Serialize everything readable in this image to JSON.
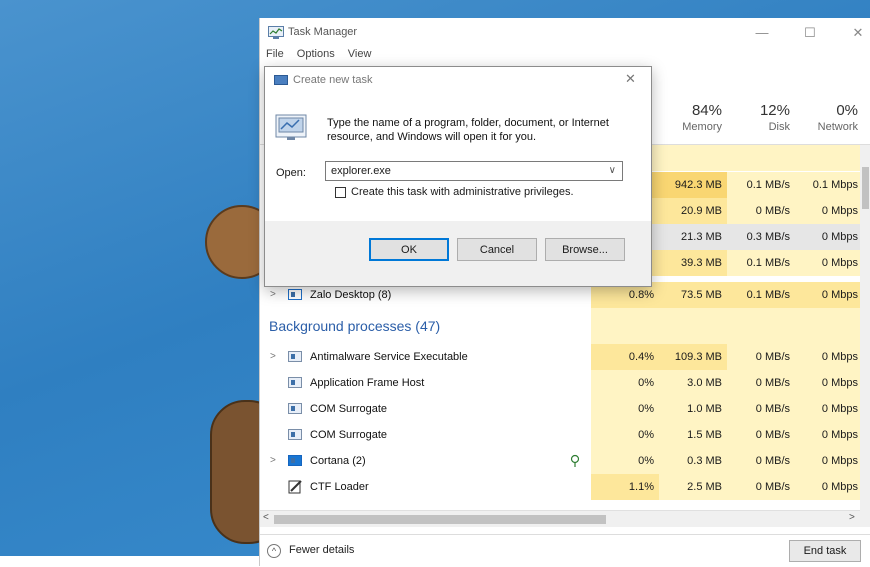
{
  "task_manager": {
    "title": "Task Manager",
    "menu": [
      "File",
      "Options",
      "View"
    ],
    "window_controls": {
      "minimize": "—",
      "maximize": "☐",
      "close": "✕"
    },
    "columns": [
      {
        "pct": "84%",
        "label": "Memory"
      },
      {
        "pct": "12%",
        "label": "Disk"
      },
      {
        "pct": "0%",
        "label": "Network"
      }
    ],
    "hidden_rows": [
      {
        "memory": "942.3 MB",
        "disk": "0.1 MB/s",
        "network": "0.1 Mbps"
      },
      {
        "memory": "20.9 MB",
        "disk": "0 MB/s",
        "network": "0 Mbps"
      },
      {
        "memory": "21.3 MB",
        "disk": "0.3 MB/s",
        "network": "0 Mbps"
      },
      {
        "memory": "39.3 MB",
        "disk": "0.1 MB/s",
        "network": "0 Mbps"
      }
    ],
    "app_row": {
      "name": "Zalo Desktop (8)",
      "cpu": "0.8%",
      "memory": "73.5 MB",
      "disk": "0.1 MB/s",
      "network": "0 Mbps"
    },
    "section_title": "Background processes (47)",
    "processes": [
      {
        "name": "Antimalware Service Executable",
        "cpu": "0.4%",
        "memory": "109.3 MB",
        "disk": "0 MB/s",
        "network": "0 Mbps"
      },
      {
        "name": "Application Frame Host",
        "cpu": "0%",
        "memory": "3.0 MB",
        "disk": "0 MB/s",
        "network": "0 Mbps"
      },
      {
        "name": "COM Surrogate",
        "cpu": "0%",
        "memory": "1.0 MB",
        "disk": "0 MB/s",
        "network": "0 Mbps"
      },
      {
        "name": "COM Surrogate",
        "cpu": "0%",
        "memory": "1.5 MB",
        "disk": "0 MB/s",
        "network": "0 Mbps"
      },
      {
        "name": "Cortana (2)",
        "cpu": "0%",
        "memory": "0.3 MB",
        "disk": "0 MB/s",
        "network": "0 Mbps"
      },
      {
        "name": "CTF Loader",
        "cpu": "1.1%",
        "memory": "2.5 MB",
        "disk": "0 MB/s",
        "network": "0 Mbps"
      }
    ],
    "footer": {
      "fewer_details": "Fewer details",
      "end_task": "End task"
    }
  },
  "dialog": {
    "title": "Create new task",
    "description": "Type the name of a program, folder, document, or Internet resource, and Windows will open it for you.",
    "open_label": "Open:",
    "open_value": "explorer.exe",
    "admin_checkbox_label": "Create this task with administrative privileges.",
    "buttons": {
      "ok": "OK",
      "cancel": "Cancel",
      "browse": "Browse..."
    }
  },
  "colors": {
    "accent": "#0078d7",
    "section": "#2b5ea8",
    "heat_light": "#fff4c4",
    "heat_mid": "#fde79b",
    "heat_high": "#f9d672"
  }
}
